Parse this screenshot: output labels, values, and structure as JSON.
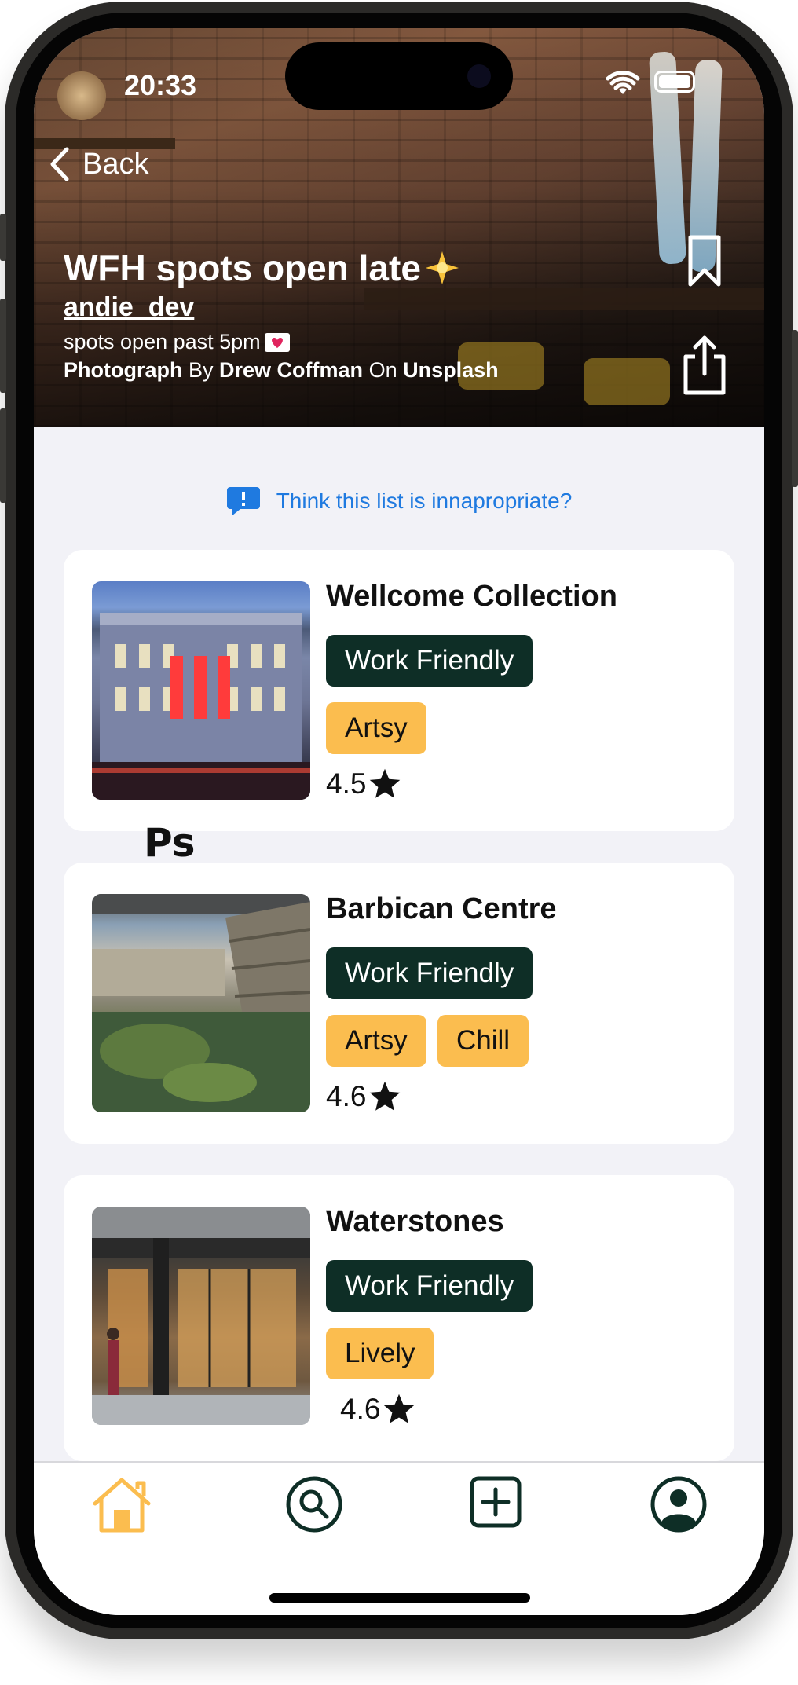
{
  "status_bar": {
    "time": "20:33"
  },
  "nav": {
    "back_label": "Back"
  },
  "list": {
    "title": "WFH spots open late",
    "author": "andie_dev",
    "description": "spots open past 5pm",
    "credit": {
      "prefix": "Photograph",
      "by": "By",
      "photographer": "Drew Coffman",
      "on": "On",
      "source": "Unsplash"
    }
  },
  "report_link": "Think this list is innapropriate?",
  "overlay_text": "Ps",
  "places": [
    {
      "name": "Wellcome Collection",
      "primary_tag": "Work Friendly",
      "tags": [
        "Artsy"
      ],
      "rating": "4.5"
    },
    {
      "name": "Barbican Centre",
      "primary_tag": "Work Friendly",
      "tags": [
        "Artsy",
        "Chill"
      ],
      "rating": "4.6"
    },
    {
      "name": "Waterstones",
      "primary_tag": "Work Friendly",
      "tags": [
        "Lively"
      ],
      "rating": "4.6"
    }
  ],
  "tabbar": {
    "items": [
      {
        "icon": "home-icon",
        "active": true
      },
      {
        "icon": "search-icon",
        "active": false
      },
      {
        "icon": "add-icon",
        "active": false
      },
      {
        "icon": "profile-icon",
        "active": false
      }
    ]
  },
  "colors": {
    "accent": "#fbbd4f",
    "tag_dark": "#0e2e26",
    "link": "#1f7ae0",
    "background": "#f2f2f7"
  }
}
